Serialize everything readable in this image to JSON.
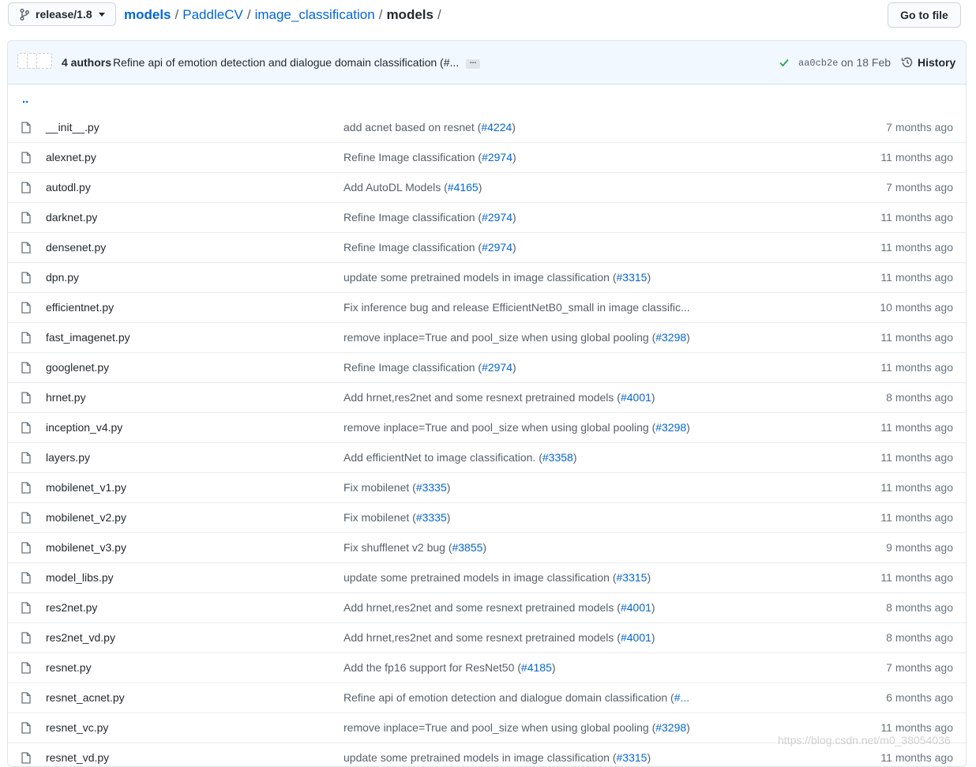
{
  "branch": {
    "label": "release/1.8"
  },
  "breadcrumb": {
    "repo": "models",
    "dir1": "PaddleCV",
    "dir2": "image_classification",
    "current": "models",
    "sep": "/"
  },
  "goto_file": {
    "label": "Go to file"
  },
  "commit": {
    "authors": "4 authors",
    "message": "Refine api of emotion detection and dialogue domain classification (#...",
    "ellipsis": "...",
    "sha": "aa0cb2e",
    "date": "on 18 Feb",
    "history_label": "History"
  },
  "updir": "..",
  "files": [
    {
      "name": "__init__.py",
      "msg": "add acnet based on resnet (",
      "link": "#4224",
      "close": ")",
      "age": "7 months ago"
    },
    {
      "name": "alexnet.py",
      "msg": "Refine Image classification (",
      "link": "#2974",
      "close": ")",
      "age": "11 months ago"
    },
    {
      "name": "autodl.py",
      "msg": "Add AutoDL Models (",
      "link": "#4165",
      "close": ")",
      "age": "7 months ago"
    },
    {
      "name": "darknet.py",
      "msg": "Refine Image classification (",
      "link": "#2974",
      "close": ")",
      "age": "11 months ago"
    },
    {
      "name": "densenet.py",
      "msg": "Refine Image classification (",
      "link": "#2974",
      "close": ")",
      "age": "11 months ago"
    },
    {
      "name": "dpn.py",
      "msg": "update some pretrained models in image classification (",
      "link": "#3315",
      "close": ")",
      "age": "11 months ago"
    },
    {
      "name": "efficientnet.py",
      "msg": "Fix inference bug and release EfficientNetB0_small in image classific...",
      "link": "",
      "close": "",
      "age": "10 months ago"
    },
    {
      "name": "fast_imagenet.py",
      "msg": "remove inplace=True and pool_size when using global pooling (",
      "link": "#3298",
      "close": ")",
      "age": "11 months ago"
    },
    {
      "name": "googlenet.py",
      "msg": "Refine Image classification (",
      "link": "#2974",
      "close": ")",
      "age": "11 months ago"
    },
    {
      "name": "hrnet.py",
      "msg": "Add hrnet,res2net and some resnext pretrained models (",
      "link": "#4001",
      "close": ")",
      "age": "8 months ago"
    },
    {
      "name": "inception_v4.py",
      "msg": "remove inplace=True and pool_size when using global pooling (",
      "link": "#3298",
      "close": ")",
      "age": "11 months ago"
    },
    {
      "name": "layers.py",
      "msg": "Add efficientNet to image classification. (",
      "link": "#3358",
      "close": ")",
      "age": "11 months ago"
    },
    {
      "name": "mobilenet_v1.py",
      "msg": "Fix mobilenet (",
      "link": "#3335",
      "close": ")",
      "age": "11 months ago"
    },
    {
      "name": "mobilenet_v2.py",
      "msg": "Fix mobilenet (",
      "link": "#3335",
      "close": ")",
      "age": "11 months ago"
    },
    {
      "name": "mobilenet_v3.py",
      "msg": "Fix shufflenet v2 bug (",
      "link": "#3855",
      "close": ")",
      "age": "9 months ago"
    },
    {
      "name": "model_libs.py",
      "msg": "update some pretrained models in image classification (",
      "link": "#3315",
      "close": ")",
      "age": "11 months ago"
    },
    {
      "name": "res2net.py",
      "msg": "Add hrnet,res2net and some resnext pretrained models (",
      "link": "#4001",
      "close": ")",
      "age": "8 months ago"
    },
    {
      "name": "res2net_vd.py",
      "msg": "Add hrnet,res2net and some resnext pretrained models (",
      "link": "#4001",
      "close": ")",
      "age": "8 months ago"
    },
    {
      "name": "resnet.py",
      "msg": "Add the fp16 support for ResNet50 (",
      "link": "#4185",
      "close": ")",
      "age": "7 months ago"
    },
    {
      "name": "resnet_acnet.py",
      "msg": "Refine api of emotion detection and dialogue domain classification (",
      "link": "#...",
      "close": "",
      "age": "6 months ago"
    },
    {
      "name": "resnet_vc.py",
      "msg": "remove inplace=True and pool_size when using global pooling (",
      "link": "#3298",
      "close": ")",
      "age": "11 months ago"
    },
    {
      "name": "resnet_vd.py",
      "msg": "update some pretrained models in image classification (",
      "link": "#3315",
      "close": ")",
      "age": "11 months ago"
    }
  ],
  "watermark": "https://blog.csdn.net/m0_38054036"
}
